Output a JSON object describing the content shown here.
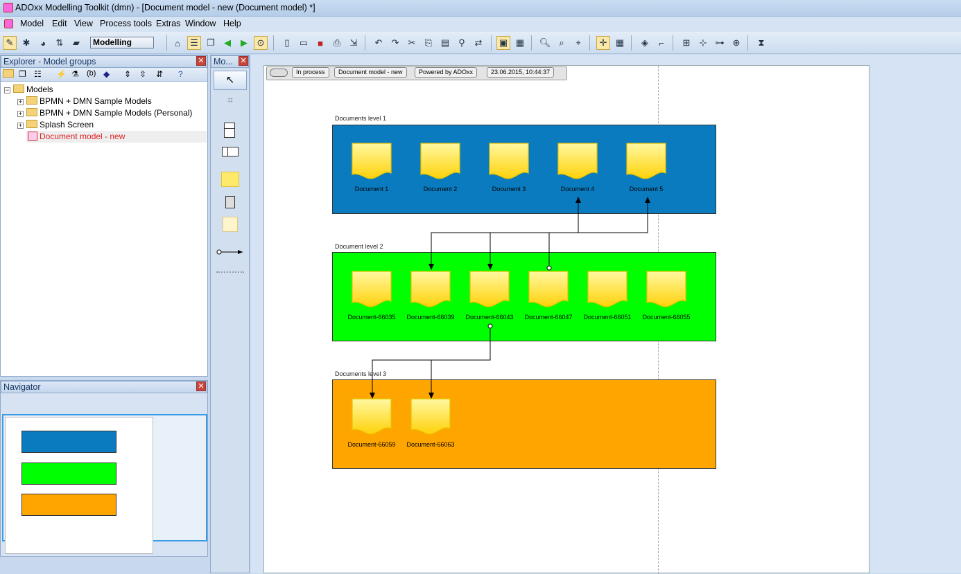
{
  "window": {
    "title": "ADOxx Modelling Toolkit (dmn) - [Document model - new (Document model) *]"
  },
  "menu": [
    "Model",
    "Edit",
    "View",
    "Process tools",
    "Extras",
    "Window",
    "Help"
  ],
  "toolbar": {
    "mode": "Modelling"
  },
  "explorer": {
    "title": "Explorer - Model groups",
    "root": "Models",
    "items": [
      {
        "label": "BPMN + DMN Sample Models"
      },
      {
        "label": "BPMN + DMN Sample Models (Personal)"
      },
      {
        "label": "Splash Screen"
      },
      {
        "label": "Document model - new"
      }
    ]
  },
  "navigator": {
    "title": "Navigator"
  },
  "modelling_bar": {
    "title": "Mo..."
  },
  "canvas": {
    "tags": [
      "In process",
      "Document model - new",
      "Powered by ADOxx",
      "23.06.2015, 10:44:37"
    ],
    "lanes": [
      {
        "label": "Documents level 1",
        "color": "#0a7bbf",
        "docs": [
          "Document 1",
          "Document 2",
          "Document 3",
          "Document 4",
          "Document 5"
        ]
      },
      {
        "label": "Document level 2",
        "color": "#00ff00",
        "docs": [
          "Document-66035",
          "Document-66039",
          "Document-66043",
          "Document-66047",
          "Document-66051",
          "Document-66055"
        ]
      },
      {
        "label": "Documents level 3",
        "color": "#ffa500",
        "docs": [
          "Document-66059",
          "Document-66063"
        ]
      }
    ]
  }
}
